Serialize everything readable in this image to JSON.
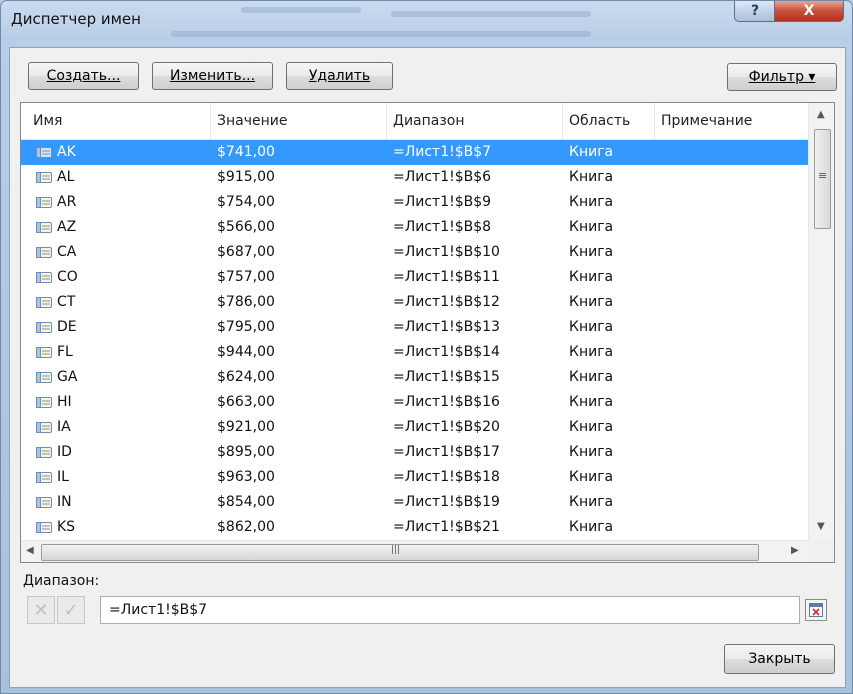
{
  "window": {
    "title": "Диспетчер имен",
    "help_icon": "?",
    "close_icon": "X"
  },
  "toolbar": {
    "create_label": "Создать...",
    "edit_label": "Изменить...",
    "delete_label": "Удалить",
    "filter_label": "Фильтр ▾"
  },
  "table": {
    "columns": [
      "Имя",
      "Значение",
      "Диапазон",
      "Область",
      "Примечание"
    ],
    "rows": [
      {
        "name": "AK",
        "value": "$741,00",
        "range": "=Лист1!$B$7",
        "scope": "Книга",
        "selected": true
      },
      {
        "name": "AL",
        "value": "$915,00",
        "range": "=Лист1!$B$6",
        "scope": "Книга"
      },
      {
        "name": "AR",
        "value": "$754,00",
        "range": "=Лист1!$B$9",
        "scope": "Книга"
      },
      {
        "name": "AZ",
        "value": "$566,00",
        "range": "=Лист1!$B$8",
        "scope": "Книга"
      },
      {
        "name": "CA",
        "value": "$687,00",
        "range": "=Лист1!$B$10",
        "scope": "Книга"
      },
      {
        "name": "CO",
        "value": "$757,00",
        "range": "=Лист1!$B$11",
        "scope": "Книга"
      },
      {
        "name": "CT",
        "value": "$786,00",
        "range": "=Лист1!$B$12",
        "scope": "Книга"
      },
      {
        "name": "DE",
        "value": "$795,00",
        "range": "=Лист1!$B$13",
        "scope": "Книга"
      },
      {
        "name": "FL",
        "value": "$944,00",
        "range": "=Лист1!$B$14",
        "scope": "Книга"
      },
      {
        "name": "GA",
        "value": "$624,00",
        "range": "=Лист1!$B$15",
        "scope": "Книга"
      },
      {
        "name": "HI",
        "value": "$663,00",
        "range": "=Лист1!$B$16",
        "scope": "Книга"
      },
      {
        "name": "IA",
        "value": "$921,00",
        "range": "=Лист1!$B$20",
        "scope": "Книга"
      },
      {
        "name": "ID",
        "value": "$895,00",
        "range": "=Лист1!$B$17",
        "scope": "Книга"
      },
      {
        "name": "IL",
        "value": "$963,00",
        "range": "=Лист1!$B$18",
        "scope": "Книга"
      },
      {
        "name": "IN",
        "value": "$854,00",
        "range": "=Лист1!$B$19",
        "scope": "Книга"
      },
      {
        "name": "KS",
        "value": "$862,00",
        "range": "=Лист1!$B$21",
        "scope": "Книга"
      }
    ]
  },
  "range_section": {
    "label": "Диапазон:",
    "cancel_icon": "✕",
    "accept_icon": "✓",
    "value": "=Лист1!$B$7"
  },
  "footer": {
    "close_label": "Закрыть"
  },
  "colors": {
    "selection": "#3399ff",
    "close_button": "#c9503a"
  }
}
